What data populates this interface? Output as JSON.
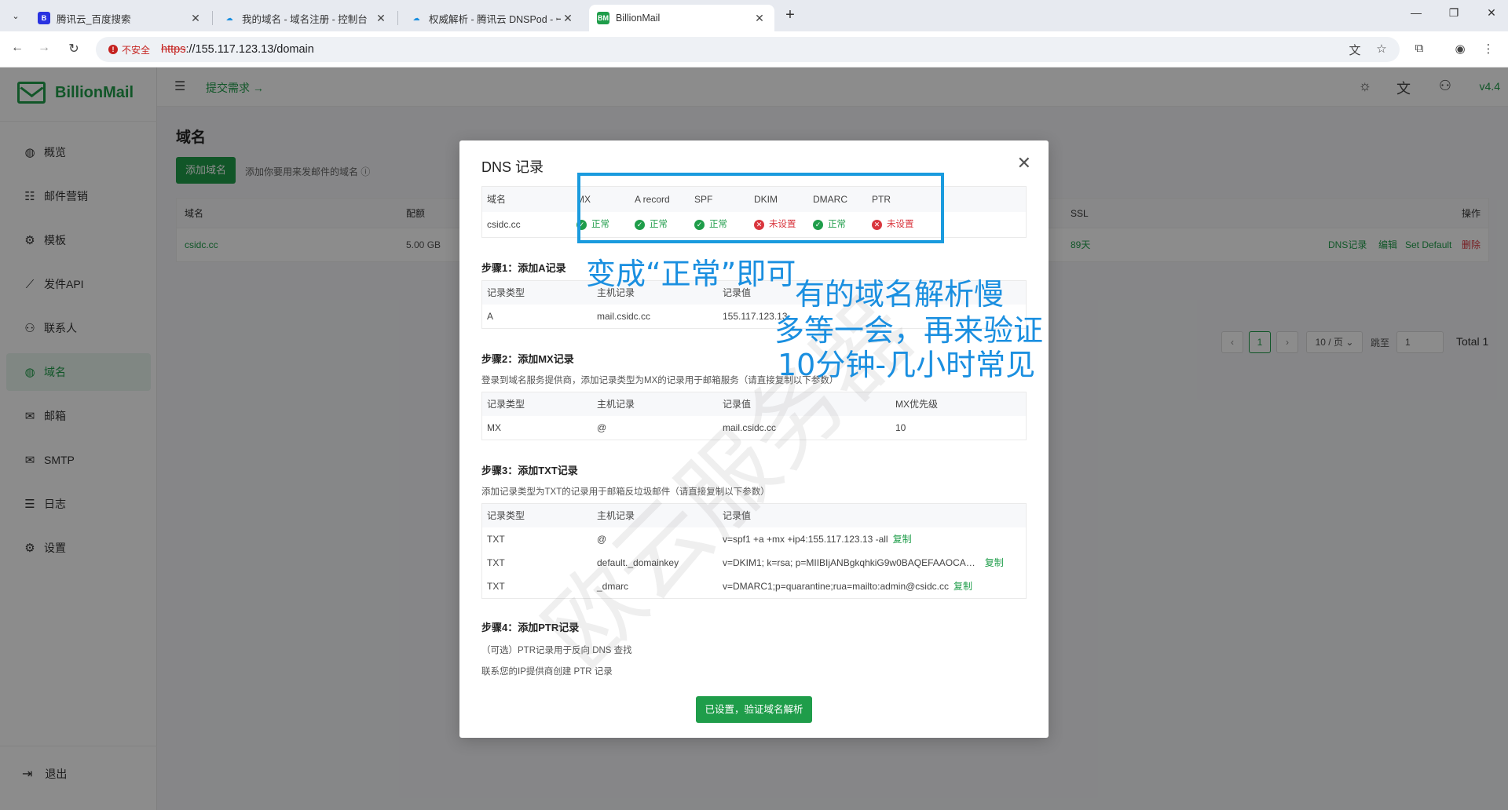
{
  "browser": {
    "tabs": [
      {
        "title": "腾讯云_百度搜索",
        "favicon": "B",
        "color": "#2932e1"
      },
      {
        "title": "我的域名 - 域名注册 - 控制台",
        "favicon": "☁",
        "color": "#1a8fe0"
      },
      {
        "title": "权威解析 - 腾讯云 DNSPod - ꟷ",
        "favicon": "☁",
        "color": "#1a8fe0"
      },
      {
        "title": "BillionMail",
        "favicon": "BM",
        "color": "#1f9d4a"
      }
    ],
    "insecure_label": "不安全",
    "url_scheme": "https",
    "url_rest": "://155.117.123.13/domain"
  },
  "app": {
    "brand": "BillionMail",
    "menu": [
      {
        "label": "概览",
        "icon": "globe-icon",
        "glyph": "◍"
      },
      {
        "label": "邮件营销",
        "icon": "campaign-icon",
        "glyph": "☷"
      },
      {
        "label": "模板",
        "icon": "gear-icon",
        "glyph": "⚙"
      },
      {
        "label": "发件API",
        "icon": "chart-icon",
        "glyph": "⟋"
      },
      {
        "label": "联系人",
        "icon": "contacts-icon",
        "glyph": "⚇"
      },
      {
        "label": "域名",
        "icon": "globe-icon",
        "glyph": "◍"
      },
      {
        "label": "邮箱",
        "icon": "mailbox-icon",
        "glyph": "✉"
      },
      {
        "label": "SMTP",
        "icon": "smtp-icon",
        "glyph": "✉"
      },
      {
        "label": "日志",
        "icon": "log-icon",
        "glyph": "☰"
      },
      {
        "label": "设置",
        "icon": "settings-icon",
        "glyph": "⚙"
      }
    ],
    "active_menu": "域名",
    "logout": "退出",
    "topbar": {
      "request": "提交需求 →",
      "version": "v4.4"
    },
    "page_title": "域名",
    "add_button": "添加域名",
    "add_hint": "添加你要用来发邮件的域名 ⓘ",
    "table": {
      "headers": {
        "domain": "域名",
        "quota": "配额",
        "ssl": "SSL",
        "actions": "操作"
      },
      "row": {
        "domain": "csidc.cc",
        "quota": "5.00 GB",
        "ssl": "89天",
        "dns": "DNS记录",
        "edit": "编辑",
        "default": "Set Default",
        "delete": "删除"
      }
    },
    "pager": {
      "current": "1",
      "page_size": "10 / 页",
      "jump_label": "跳至",
      "jump_value": "1",
      "total": "Total 1"
    }
  },
  "modal": {
    "title": "DNS 记录",
    "status_headers": [
      "域名",
      "MX",
      "A record",
      "SPF",
      "DKIM",
      "DMARC",
      "PTR"
    ],
    "status_row": {
      "domain": "csidc.cc",
      "items": [
        {
          "label": "正常",
          "ok": true
        },
        {
          "label": "正常",
          "ok": true
        },
        {
          "label": "正常",
          "ok": true
        },
        {
          "label": "未设置",
          "ok": false
        },
        {
          "label": "正常",
          "ok": true
        },
        {
          "label": "未设置",
          "ok": false
        }
      ]
    },
    "step1": {
      "title": "步骤1：添加A记录",
      "headers": [
        "记录类型",
        "主机记录",
        "记录值"
      ],
      "rows": [
        [
          "A",
          "mail.csidc.cc",
          "155.117.123.13"
        ]
      ]
    },
    "step2": {
      "title": "步骤2：添加MX记录",
      "desc": "登录到域名服务提供商，添加记录类型为MX的记录用于邮箱服务（请直接复制以下参数）",
      "headers": [
        "记录类型",
        "主机记录",
        "记录值",
        "MX优先级"
      ],
      "rows": [
        [
          "MX",
          "@",
          "mail.csidc.cc",
          "10"
        ]
      ]
    },
    "step3": {
      "title": "步骤3：添加TXT记录",
      "desc": "添加记录类型为TXT的记录用于邮箱反垃圾邮件（请直接复制以下参数）",
      "headers": [
        "记录类型",
        "主机记录",
        "记录值"
      ],
      "rows": [
        [
          "TXT",
          "@",
          "v=spf1 +a +mx +ip4:155.117.123.13 -all"
        ],
        [
          "TXT",
          "default._domainkey",
          "v=DKIM1; k=rsa; p=MIIBIjANBgkqhkiG9w0BAQEFAAOCA…"
        ],
        [
          "TXT",
          "_dmarc",
          "v=DMARC1;p=quarantine;rua=mailto:admin@csidc.cc"
        ]
      ],
      "copy": "复制"
    },
    "step4": {
      "title": "步骤4：添加PTR记录",
      "line1": "（可选）PTR记录用于反向 DNS 查找",
      "line2": "联系您的IP提供商创建 PTR 记录"
    },
    "verify_button": "已设置，验证域名解析"
  },
  "annotations": {
    "a1": "变成“正常”即可",
    "a2": "有的域名解析慢",
    "a3": "多等一会，再来验证",
    "a4": "10分钟-几小时常见"
  },
  "colors": {
    "brand": "#1f9d4a",
    "error": "#d9363e",
    "annotation": "#1a9bde"
  }
}
